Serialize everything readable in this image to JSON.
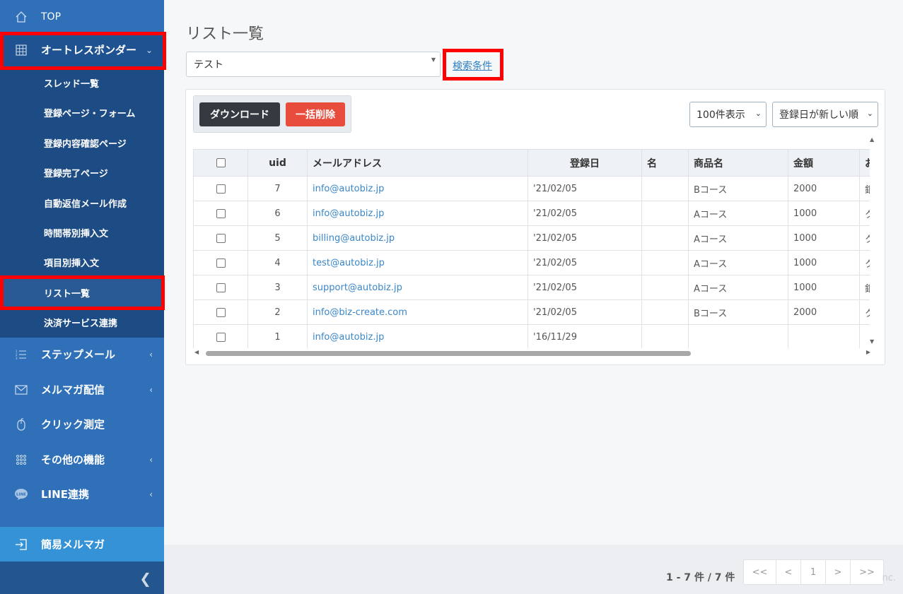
{
  "sidebar": {
    "top_label": "TOP",
    "autoresponder_label": "オートレスポンダー",
    "submenu": [
      "スレッド一覧",
      "登録ページ・フォーム",
      "登録内容確認ページ",
      "登録完了ページ",
      "自動返信メール作成",
      "時間帯別挿入文",
      "項目別挿入文",
      "リスト一覧",
      "決済サービス連携"
    ],
    "step_mail": "ステップメール",
    "mailmag": "メルマガ配信",
    "click": "クリック測定",
    "other": "その他の機能",
    "line": "LINE連携",
    "simple_mailmag": "簡易メルマガ",
    "line_badge": "LINE"
  },
  "main": {
    "title": "リスト一覧",
    "filter_value": "テスト",
    "search_link": "検索条件",
    "download_label": "ダウンロード",
    "delete_label": "一括削除",
    "per_page": "100件表示",
    "sort": "登録日が新しい順"
  },
  "table": {
    "headers": [
      "uid",
      "メールアドレス",
      "登録日",
      "名",
      "商品名",
      "金額",
      "お"
    ],
    "rows": [
      {
        "uid": "7",
        "email": "info@autobiz.jp",
        "date": "'21/02/05",
        "name": "",
        "product": "Bコース",
        "amount": "2000",
        "extra": "銀"
      },
      {
        "uid": "6",
        "email": "info@autobiz.jp",
        "date": "'21/02/05",
        "name": "",
        "product": "Aコース",
        "amount": "1000",
        "extra": "ク"
      },
      {
        "uid": "5",
        "email": "billing@autobiz.jp",
        "date": "'21/02/05",
        "name": "",
        "product": "Aコース",
        "amount": "1000",
        "extra": "ク"
      },
      {
        "uid": "4",
        "email": "test@autobiz.jp",
        "date": "'21/02/05",
        "name": "",
        "product": "Aコース",
        "amount": "1000",
        "extra": "ク"
      },
      {
        "uid": "3",
        "email": "support@autobiz.jp",
        "date": "'21/02/05",
        "name": "",
        "product": "Aコース",
        "amount": "1000",
        "extra": "銀"
      },
      {
        "uid": "2",
        "email": "info@biz-create.com",
        "date": "'21/02/05",
        "name": "",
        "product": "Bコース",
        "amount": "2000",
        "extra": "ク"
      },
      {
        "uid": "1",
        "email": "info@autobiz.jp",
        "date": "'16/11/29",
        "name": "",
        "product": "",
        "amount": "",
        "extra": ""
      }
    ]
  },
  "pagination": {
    "count_text": "1 - 7 件 / 7 件",
    "first": "<<",
    "prev": "<",
    "current": "1",
    "next": ">",
    "last": ">>"
  },
  "copyright_fragment": "nc."
}
